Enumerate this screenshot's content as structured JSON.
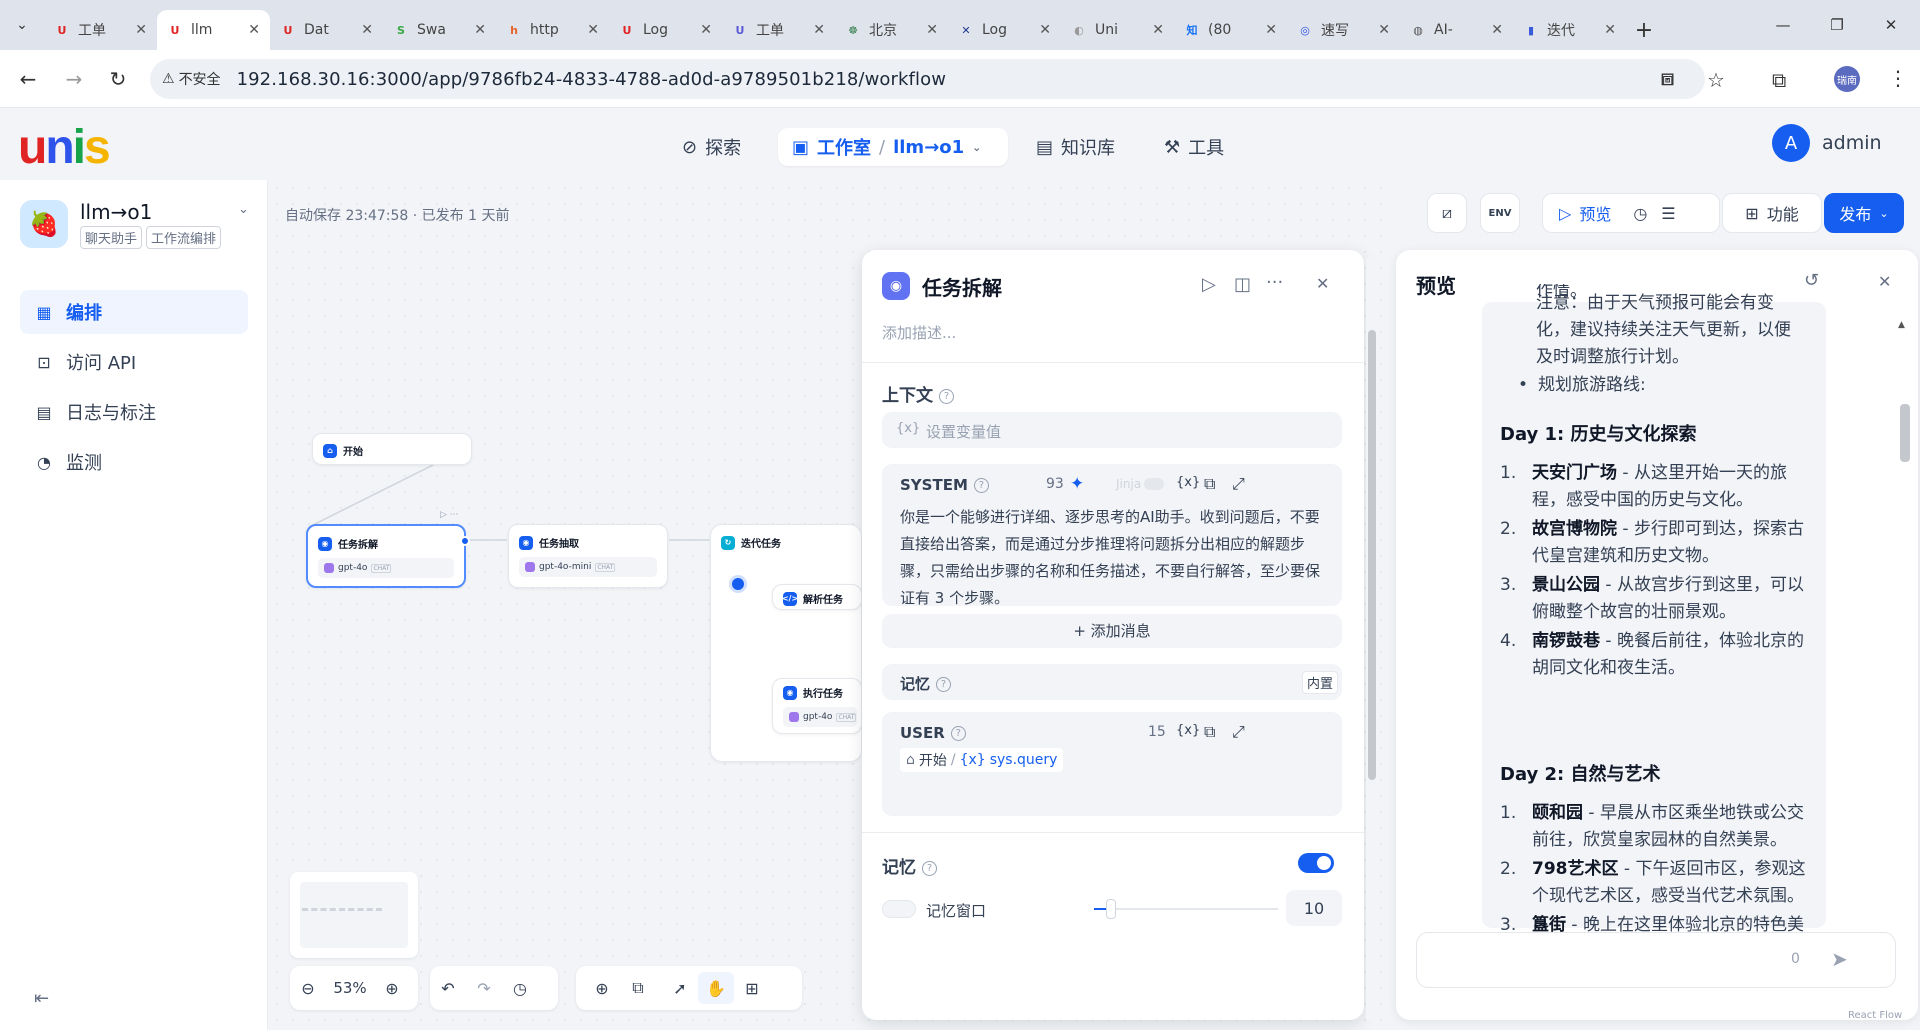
{
  "browser": {
    "tabs": [
      {
        "label": "工单",
        "icon": "U",
        "color": "#e02424"
      },
      {
        "label": "llm",
        "icon": "U",
        "color": "#e02424"
      },
      {
        "label": "Dat",
        "icon": "U",
        "color": "#e02424"
      },
      {
        "label": "Swa",
        "icon": "S",
        "color": "#39a845"
      },
      {
        "label": "http",
        "icon": "h",
        "color": "#e8632b"
      },
      {
        "label": "Log",
        "icon": "U",
        "color": "#e02424"
      },
      {
        "label": "工单",
        "icon": "U",
        "color": "#5b5bd6"
      },
      {
        "label": "北京",
        "icon": "☸",
        "color": "#2f7d4a"
      },
      {
        "label": "Log",
        "icon": "✕",
        "color": "#1d3c8f"
      },
      {
        "label": "Uni",
        "icon": "◐",
        "color": "#999999"
      },
      {
        "label": "(80",
        "icon": "知",
        "color": "#1772f6"
      },
      {
        "label": "速写",
        "icon": "◎",
        "color": "#2f54eb"
      },
      {
        "label": "AI-",
        "icon": "◍",
        "color": "#555555"
      },
      {
        "label": "迭代",
        "icon": "▮",
        "color": "#3b5bdb"
      }
    ],
    "url": "192.168.30.16:3000/app/9786fb24-4833-4788-ad0d-a9789501b218/workflow",
    "insecure_label": "不安全",
    "profile": "瑞南"
  },
  "header": {
    "logo": "unis",
    "nav": {
      "explore": "探索",
      "studio": "工作室",
      "breadcrumb_sep": "/",
      "app": "llm→o1",
      "knowledge": "知识库",
      "tools": "工具"
    },
    "user_initial": "A",
    "user_name": "admin"
  },
  "sidebar": {
    "app_name": "llm→o1",
    "tag_chat": "聊天助手",
    "tag_workflow": "工作流编排",
    "items": [
      {
        "label": "编排"
      },
      {
        "label": "访问 API"
      },
      {
        "label": "日志与标注"
      },
      {
        "label": "监测"
      }
    ]
  },
  "canvas": {
    "autosave": "自动保存 23:47:58 · 已发布 1 天前",
    "zoom": "53%",
    "toolbar": {
      "preview": "预览",
      "features": "功能",
      "publish": "发布"
    },
    "nodes": {
      "start": "开始",
      "split": "任务拆解",
      "split_model": "gpt-4o",
      "extract": "任务抽取",
      "extract_model": "gpt-4o-mini",
      "iterate": "迭代任务",
      "parse": "解析任务",
      "exec": "执行任务",
      "exec_model": "gpt-4o",
      "chat_chip": "CHAT"
    }
  },
  "panel": {
    "title": "任务拆解",
    "desc_placeholder": "添加描述...",
    "context_title": "上下文",
    "context_placeholder": "设置变量值",
    "system_label": "SYSTEM",
    "system_count": "93",
    "jinja": "Jinja",
    "system_text": "你是一个能够进行详细、逐步思考的AI助手。收到问题后，不要直接给出答案，而是通过分步推理将问题拆分出相应的解题步骤，只需给出步骤的名称和任务描述，不要自行解答，至少要保证有 3 个步骤。",
    "add_message": "添加消息",
    "memory_label": "记忆",
    "builtin": "内置",
    "user_label": "USER",
    "user_count": "15",
    "var_node": "开始",
    "var_sep": "/",
    "var_name": "sys.query",
    "memory_title": "记忆",
    "window_label": "记忆窗口",
    "window_value": "10",
    "var_icon": "{x}"
  },
  "preview": {
    "title": "预览",
    "partial_top": "作情。",
    "note": "注意：由于天气预报可能会有变化，建议持续关注天气更新，以便及时调整旅行计划。",
    "bullet": "规划旅游路线:",
    "day1": "Day 1: 历史与文化探索",
    "day1_items": [
      {
        "n": "1.",
        "name": "天安门广场",
        "text": " - 从这里开始一天的旅程，感受中国的历史与文化。"
      },
      {
        "n": "2.",
        "name": "故宫博物院",
        "text": " - 步行即可到达，探索古代皇宫建筑和历史文物。"
      },
      {
        "n": "3.",
        "name": "景山公园",
        "text": " - 从故宫步行到这里，可以俯瞰整个故宫的壮丽景观。"
      },
      {
        "n": "4.",
        "name": "南锣鼓巷",
        "text": " - 晚餐后前往，体验北京的胡同文化和夜生活。"
      }
    ],
    "day2": "Day 2: 自然与艺术",
    "day2_items": [
      {
        "n": "1.",
        "name": "颐和园",
        "text": " - 早晨从市区乘坐地铁或公交前往，欣赏皇家园林的自然美景。"
      },
      {
        "n": "2.",
        "name": "798艺术区",
        "text": " - 下午返回市区，参观这个现代艺术区，感受当代艺术氛围。"
      },
      {
        "n": "3.",
        "name": "簋街",
        "text": " - 晚上在这里体验北京的特色美食。"
      }
    ],
    "input_count": "0",
    "footer": "React Flow"
  },
  "colors": {
    "accent": "#155eef",
    "logo_u": "#e02424",
    "logo_n": "#2f54eb",
    "logo_i": "#16a34a",
    "logo_s": "#f5b400"
  }
}
